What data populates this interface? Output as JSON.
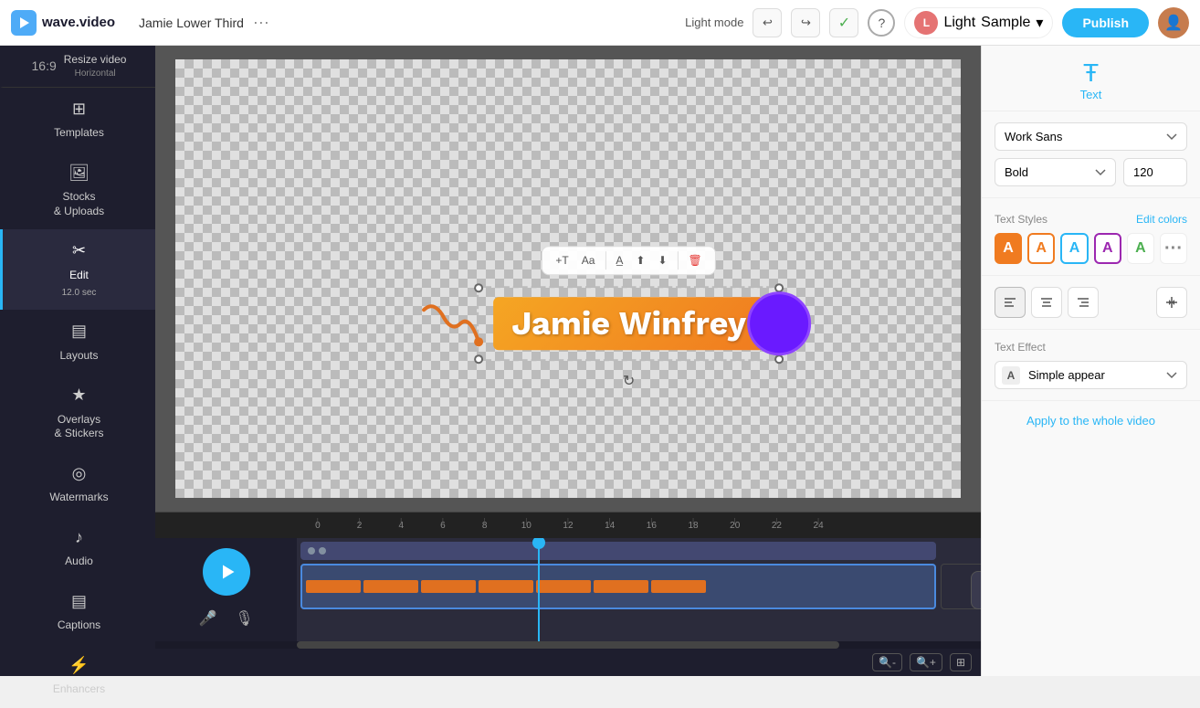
{
  "app": {
    "logo_text": "wave.video",
    "project_name": "Jamie Lower Third",
    "dots_label": "···"
  },
  "topbar": {
    "light_mode_label": "Light mode",
    "undo_icon": "↩",
    "redo_icon": "↪",
    "check_icon": "✓",
    "help_icon": "?",
    "user_initial": "L",
    "user_label": "Light",
    "sample_label": "Sample",
    "chevron": "▾",
    "publish_label": "Publish"
  },
  "sidebar": {
    "resize_label": "Resize video",
    "resize_sublabel": "Horizontal",
    "items": [
      {
        "id": "templates",
        "label": "Templates",
        "icon": "⊞"
      },
      {
        "id": "stocks",
        "label": "Stocks\n& Uploads",
        "icon": "🖼"
      },
      {
        "id": "edit",
        "label": "Edit",
        "sublabel": "12.0 sec",
        "icon": "✂",
        "active": true
      },
      {
        "id": "layouts",
        "label": "Layouts",
        "icon": "▤"
      },
      {
        "id": "overlays",
        "label": "Overlays\n& Stickers",
        "icon": "★"
      },
      {
        "id": "watermarks",
        "label": "Watermarks",
        "icon": "◎"
      },
      {
        "id": "audio",
        "label": "Audio",
        "icon": "♪"
      },
      {
        "id": "captions",
        "label": "Captions",
        "icon": "▤"
      },
      {
        "id": "enhancers",
        "label": "Enhancers",
        "icon": "⚡"
      }
    ]
  },
  "canvas": {
    "text_content": "Jamie Winfrey"
  },
  "text_toolbar": {
    "add_text": "+T",
    "font_size_tool": "Aa",
    "color_tool": "A̲",
    "upload_icon": "⬆",
    "download_icon": "⬇",
    "delete_icon": "🗑"
  },
  "right_panel": {
    "icon_label": "Text",
    "font_family": "Work Sans",
    "font_weight": "Bold",
    "font_size": "120",
    "text_styles_label": "Text Styles",
    "edit_colors_label": "Edit colors",
    "styles": [
      {
        "id": "solid-orange",
        "type": "orange-bg",
        "char": "A"
      },
      {
        "id": "outline-orange",
        "type": "orange-outline",
        "char": "A"
      },
      {
        "id": "outline-blue",
        "type": "blue-outline",
        "char": "A"
      },
      {
        "id": "outline-purple",
        "type": "purple-outline",
        "char": "A"
      },
      {
        "id": "green-text",
        "type": "green-text",
        "char": "A"
      },
      {
        "id": "more",
        "type": "dots",
        "char": "···"
      }
    ],
    "align_left": "≡",
    "align_center": "≡",
    "align_right": "≡",
    "valign": "⊤",
    "text_effect_label": "Text Effect",
    "text_effect_icon_char": "A",
    "text_effect_value": "Simple appear",
    "apply_label": "Apply to the whole video"
  },
  "timeline": {
    "ruler_marks": [
      "0",
      "2",
      "4",
      "6",
      "8",
      "10",
      "12",
      "14",
      "16",
      "18",
      "20",
      "22",
      "24"
    ],
    "play_icon": "▶",
    "add_clip_icon": "+",
    "zoom_out_icon": "🔍-",
    "zoom_in_icon": "🔍+",
    "fit_icon": "⊞"
  }
}
